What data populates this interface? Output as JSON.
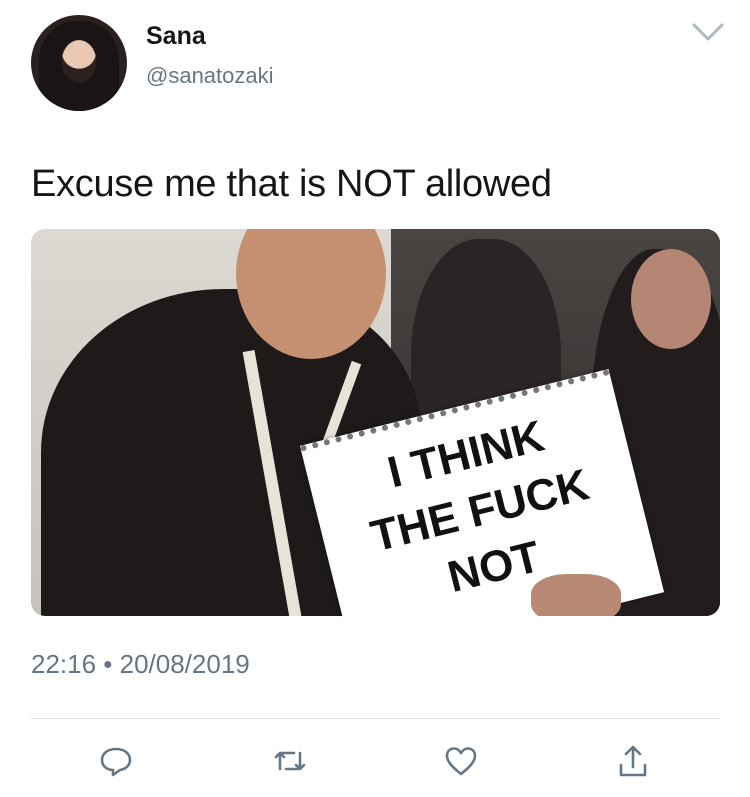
{
  "author": {
    "name": "Sana",
    "handle": "@sanatozaki"
  },
  "tweet": {
    "text": "Excuse me that is NOT allowed",
    "media": {
      "sign_lines": [
        "I THINK",
        "THE FUCK",
        "NOT"
      ]
    },
    "timestamp": "22:16 • 20/08/2019"
  },
  "icons": {
    "menu": "chevron-down-icon",
    "reply": "reply-icon",
    "retweet": "retweet-icon",
    "like": "heart-icon",
    "share": "share-icon"
  },
  "colors": {
    "text": "#14171a",
    "secondary": "#657786",
    "icon": "#657786",
    "divider": "#dfe3e6"
  }
}
